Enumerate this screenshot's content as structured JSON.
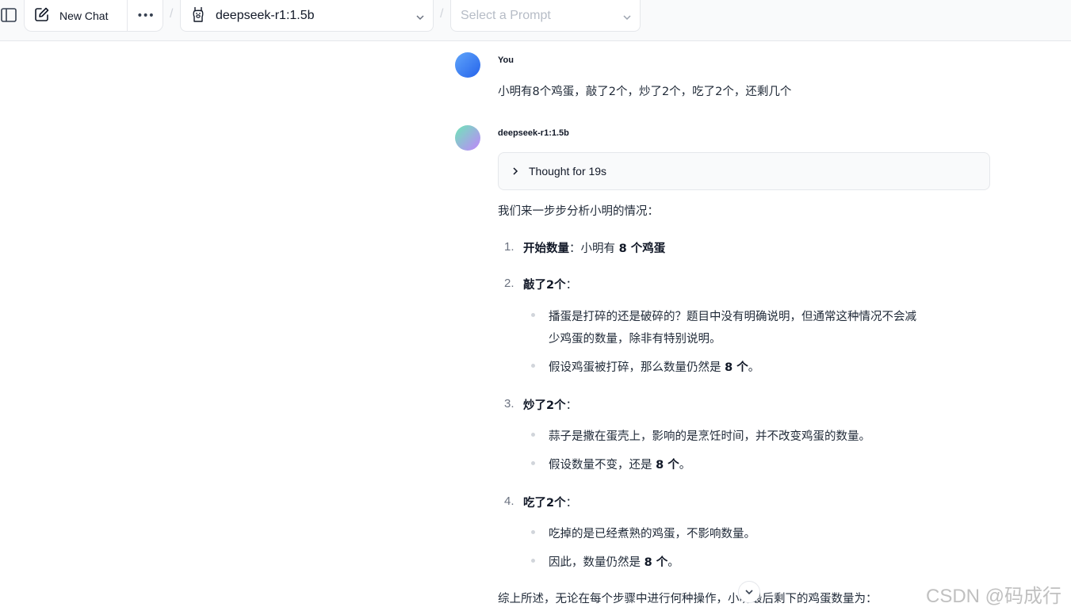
{
  "header": {
    "new_chat_label": "New Chat",
    "more_label": "•••",
    "separator": "/",
    "model_name": "deepseek-r1:1.5b",
    "prompt_placeholder": "Select a Prompt"
  },
  "user_message": {
    "sender": "You",
    "text": "小明有8个鸡蛋，敲了2个，炒了2个，吃了2个，还剩几个"
  },
  "assistant_message": {
    "sender": "deepseek-r1:1.5b",
    "thought_label": "Thought for 19s",
    "intro": "我们来一步步分析小明的情况：",
    "steps": [
      {
        "number": "1.",
        "title": "开始数量",
        "colon": "：",
        "text_before": "小明有 ",
        "bold": "8 个鸡蛋",
        "bullets": []
      },
      {
        "number": "2.",
        "title": "敲了2个",
        "colon": "：",
        "bullets": [
          {
            "line1": "播蛋是打碎的还是破碎的？题目中没有明确说明，但通常这种情况不会减",
            "line2": "少鸡蛋的数量，除非有特别说明。"
          },
          {
            "text_before": "假设鸡蛋被打碎，那么数量仍然是 ",
            "bold": "8 个",
            "text_after": "。"
          }
        ]
      },
      {
        "number": "3.",
        "title": "炒了2个",
        "colon": "：",
        "bullets": [
          {
            "text": "蒜子是撒在蛋壳上，影响的是烹饪时间，并不改变鸡蛋的数量。"
          },
          {
            "text_before": "假设数量不变，还是 ",
            "bold": "8 个",
            "text_after": "。"
          }
        ]
      },
      {
        "number": "4.",
        "title": "吃了2个",
        "colon": "：",
        "bullets": [
          {
            "text": "吃掉的是已经煮熟的鸡蛋，不影响数量。"
          },
          {
            "text_before": "因此，数量仍然是 ",
            "bold": "8 个",
            "text_after": "。"
          }
        ]
      }
    ],
    "conclusion": "综上所述，无论在每个步骤中进行何种操作，小明最后剩下的鸡蛋数量为："
  },
  "watermark": "CSDN @码成行",
  "icons": {
    "sidebar": "sidebar-toggle-icon",
    "new_chat": "pencil-square-icon",
    "model": "llama-icon",
    "chevron": "chevron-down-icon",
    "thought": "chevron-right-icon",
    "scroll": "arrow-down-icon"
  },
  "colors": {
    "user_avatar": "#2563eb",
    "bot_avatar_start": "#6ee7b7",
    "bot_avatar_end": "#c084fc"
  }
}
